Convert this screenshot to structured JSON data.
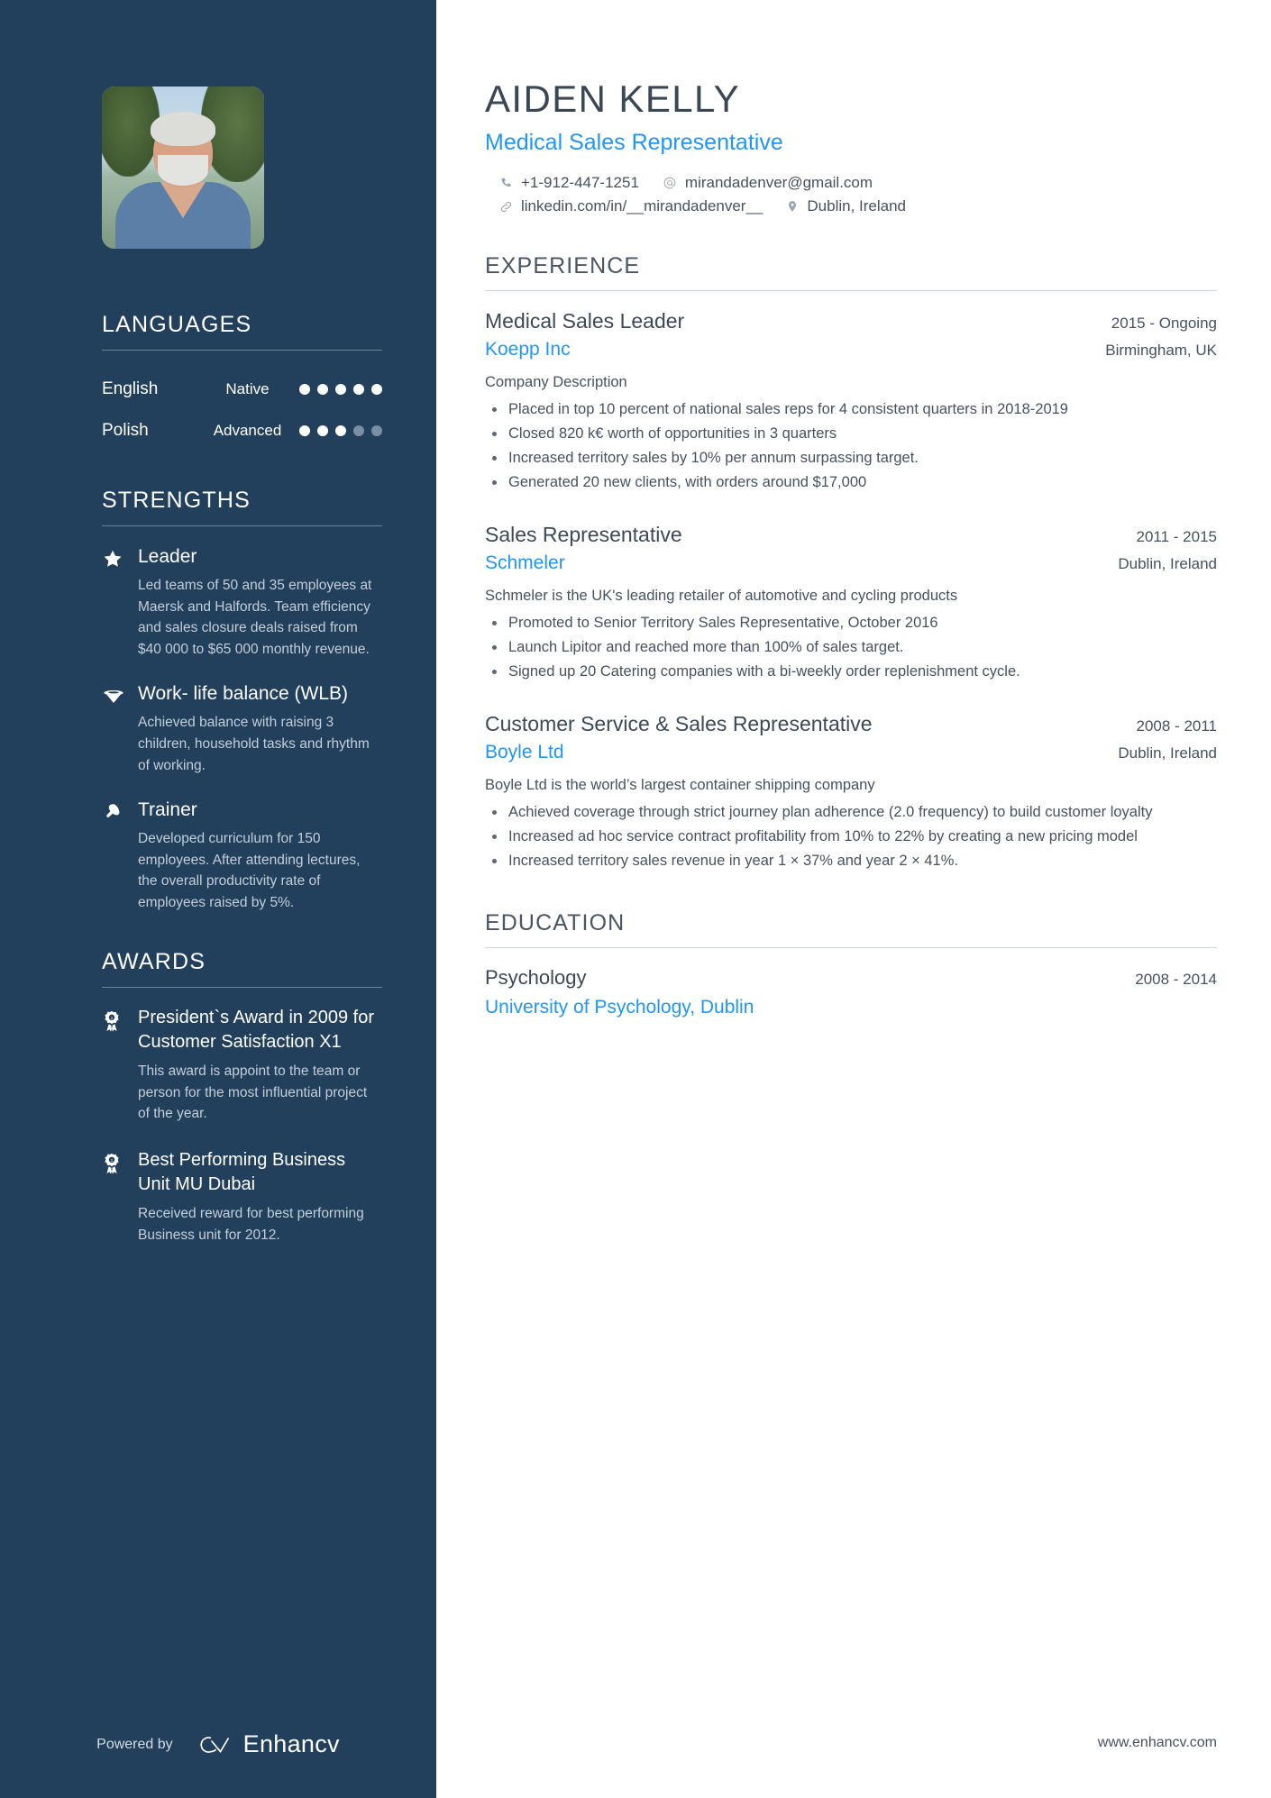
{
  "profile": {
    "name": "AIDEN KELLY",
    "role": "Medical Sales Representative",
    "photo_alt": "profile-photo"
  },
  "contact": {
    "phone": "+1-912-447-1251",
    "email": "mirandadenver@gmail.com",
    "linkedin": "linkedin.com/in/__mirandadenver__",
    "location": "Dublin, Ireland"
  },
  "sidebar": {
    "languages": {
      "title": "LANGUAGES",
      "items": [
        {
          "name": "English",
          "level": "Native",
          "filled": 5,
          "total": 5
        },
        {
          "name": "Polish",
          "level": "Advanced",
          "filled": 3,
          "total": 5
        }
      ]
    },
    "strengths": {
      "title": "STRENGTHS",
      "items": [
        {
          "icon": "star-icon",
          "name": "Leader",
          "description": "Led teams of 50 and 35 employees at Maersk and Halfords. Team efficiency and sales closure deals raised from $40 000 to $65 000 monthly revenue."
        },
        {
          "icon": "shield-badge-icon",
          "name": "Work- life balance (WLB)",
          "description": "Achieved balance with raising 3 children, household tasks and rhythm of working."
        },
        {
          "icon": "bell-icon",
          "name": "Trainer",
          "description": "Developed curriculum for 150 employees. After attending lectures, the overall productivity rate of employees raised by 5%."
        }
      ]
    },
    "awards": {
      "title": "AWARDS",
      "items": [
        {
          "icon": "award-ribbon-icon",
          "name": "President`s Award in 2009 for Customer Satisfaction X1",
          "description": "This award is appoint to the team or person for the most influential project of the year."
        },
        {
          "icon": "award-ribbon-icon",
          "name": "Best Performing Business Unit MU Dubai",
          "description": "Received reward for best performing Business unit for 2012."
        }
      ]
    },
    "footer": {
      "powered_by": "Powered by",
      "brand": "Enhancv"
    }
  },
  "main": {
    "experience": {
      "title": "EXPERIENCE",
      "jobs": [
        {
          "title": "Medical Sales Leader",
          "date": "2015 - Ongoing",
          "company": "Koepp Inc",
          "location": "Birmingham, UK",
          "description": "Company Description",
          "bullets": [
            "Placed in top 10 percent of national sales reps for 4 consistent quarters in 2018-2019",
            "Closed 820 k€ worth of opportunities in 3 quarters",
            "Increased territory sales by 10% per annum surpassing target.",
            "Generated 20 new clients, with orders around $17,000"
          ]
        },
        {
          "title": "Sales Representative",
          "date": "2011 - 2015",
          "company": "Schmeler",
          "location": "Dublin, Ireland",
          "description": "Schmeler is the UK's leading retailer of automotive and cycling products",
          "bullets": [
            "Promoted to Senior Territory Sales Representative, October 2016",
            "Launch Lipitor and reached more than 100% of sales target.",
            "Signed up 20 Catering companies with a bi-weekly order replenishment cycle."
          ]
        },
        {
          "title": "Customer Service & Sales Representative",
          "date": "2008 - 2011",
          "company": "Boyle Ltd",
          "location": "Dublin, Ireland",
          "description": "Boyle Ltd is the world’s largest container shipping company",
          "bullets": [
            "Achieved coverage through strict journey plan adherence (2.0 frequency) to build customer loyalty",
            "Increased ad hoc service contract profitability from 10% to 22% by creating a new pricing model",
            "Increased territory sales revenue in year 1 × 37% and year 2 × 41%."
          ]
        }
      ]
    },
    "education": {
      "title": "EDUCATION",
      "items": [
        {
          "degree": "Psychology",
          "date": "2008 - 2014",
          "school": "University of Psychology, Dublin"
        }
      ]
    },
    "footer_url": "www.enhancv.com"
  },
  "colors": {
    "sidebar_bg": "#22405c",
    "accent": "#2196f3",
    "body_text": "#46525f",
    "heading": "#3d4956"
  }
}
